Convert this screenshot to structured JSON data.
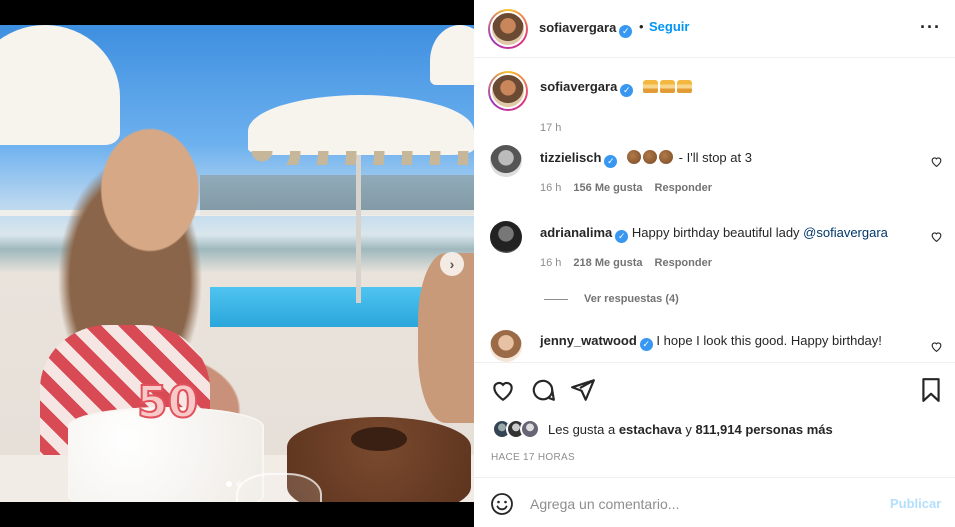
{
  "post": {
    "author": "sofiavergara",
    "follow_label": "Seguir",
    "separator": "•",
    "more_icon": "more-horizontal-icon",
    "caption_author": "sofiavergara",
    "caption_age": "17 h"
  },
  "comments": [
    {
      "user": "tizzielisch",
      "text": " - I'll stop at 3",
      "age": "16 h",
      "likes": "156 Me gusta",
      "reply": "Responder"
    },
    {
      "user": "adrianalima",
      "text": "Happy birthday beautiful lady ",
      "mention": "@sofiavergara",
      "age": "16 h",
      "likes": "218 Me gusta",
      "reply": "Responder",
      "view_replies": "Ver respuestas (4)"
    },
    {
      "user": "jenny_watwood",
      "text": "I hope I look this good. Happy birthday!"
    }
  ],
  "likes": {
    "prefix": "Les gusta a ",
    "first_user": "estachava",
    "middle": " y ",
    "others": "811,914 personas más"
  },
  "timestamp": "HACE 17 HORAS",
  "composer": {
    "placeholder": "Agrega un comentario...",
    "post_label": "Publicar"
  },
  "carousel": {
    "current": 1,
    "total": 2
  },
  "colors": {
    "accent": "#0095f6",
    "verified": "#3897f0",
    "post_disabled": "#b2dffc"
  }
}
